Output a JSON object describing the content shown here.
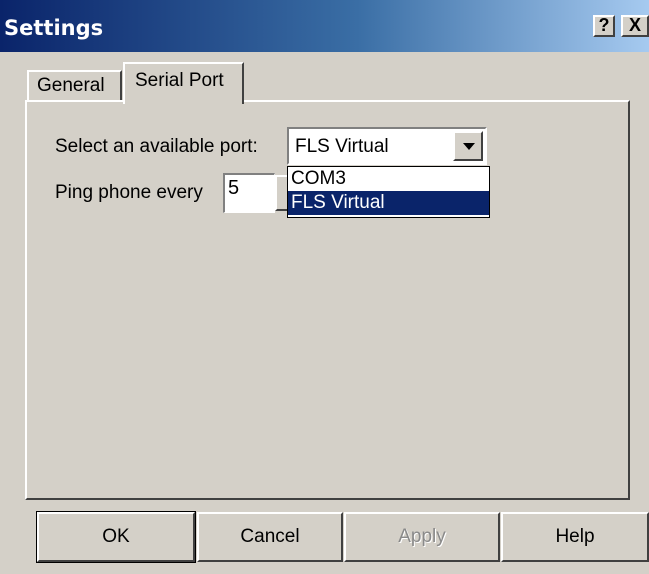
{
  "window": {
    "title": "Settings",
    "help_glyph": "?",
    "close_glyph": "X"
  },
  "tabs": [
    {
      "label": "General",
      "active": false
    },
    {
      "label": "Serial Port",
      "active": true
    }
  ],
  "serial_port": {
    "port_label": "Select an available port:",
    "port_selected": "FLS Virtual",
    "port_options": [
      "COM3",
      "FLS Virtual"
    ],
    "ping_label": "Ping phone every",
    "ping_value": "5"
  },
  "buttons": {
    "ok": "OK",
    "cancel": "Cancel",
    "apply": "Apply",
    "help": "Help"
  },
  "colors": {
    "title_bar": "#0a246a",
    "face": "#d4d0c8",
    "selection": "#0a246a"
  }
}
